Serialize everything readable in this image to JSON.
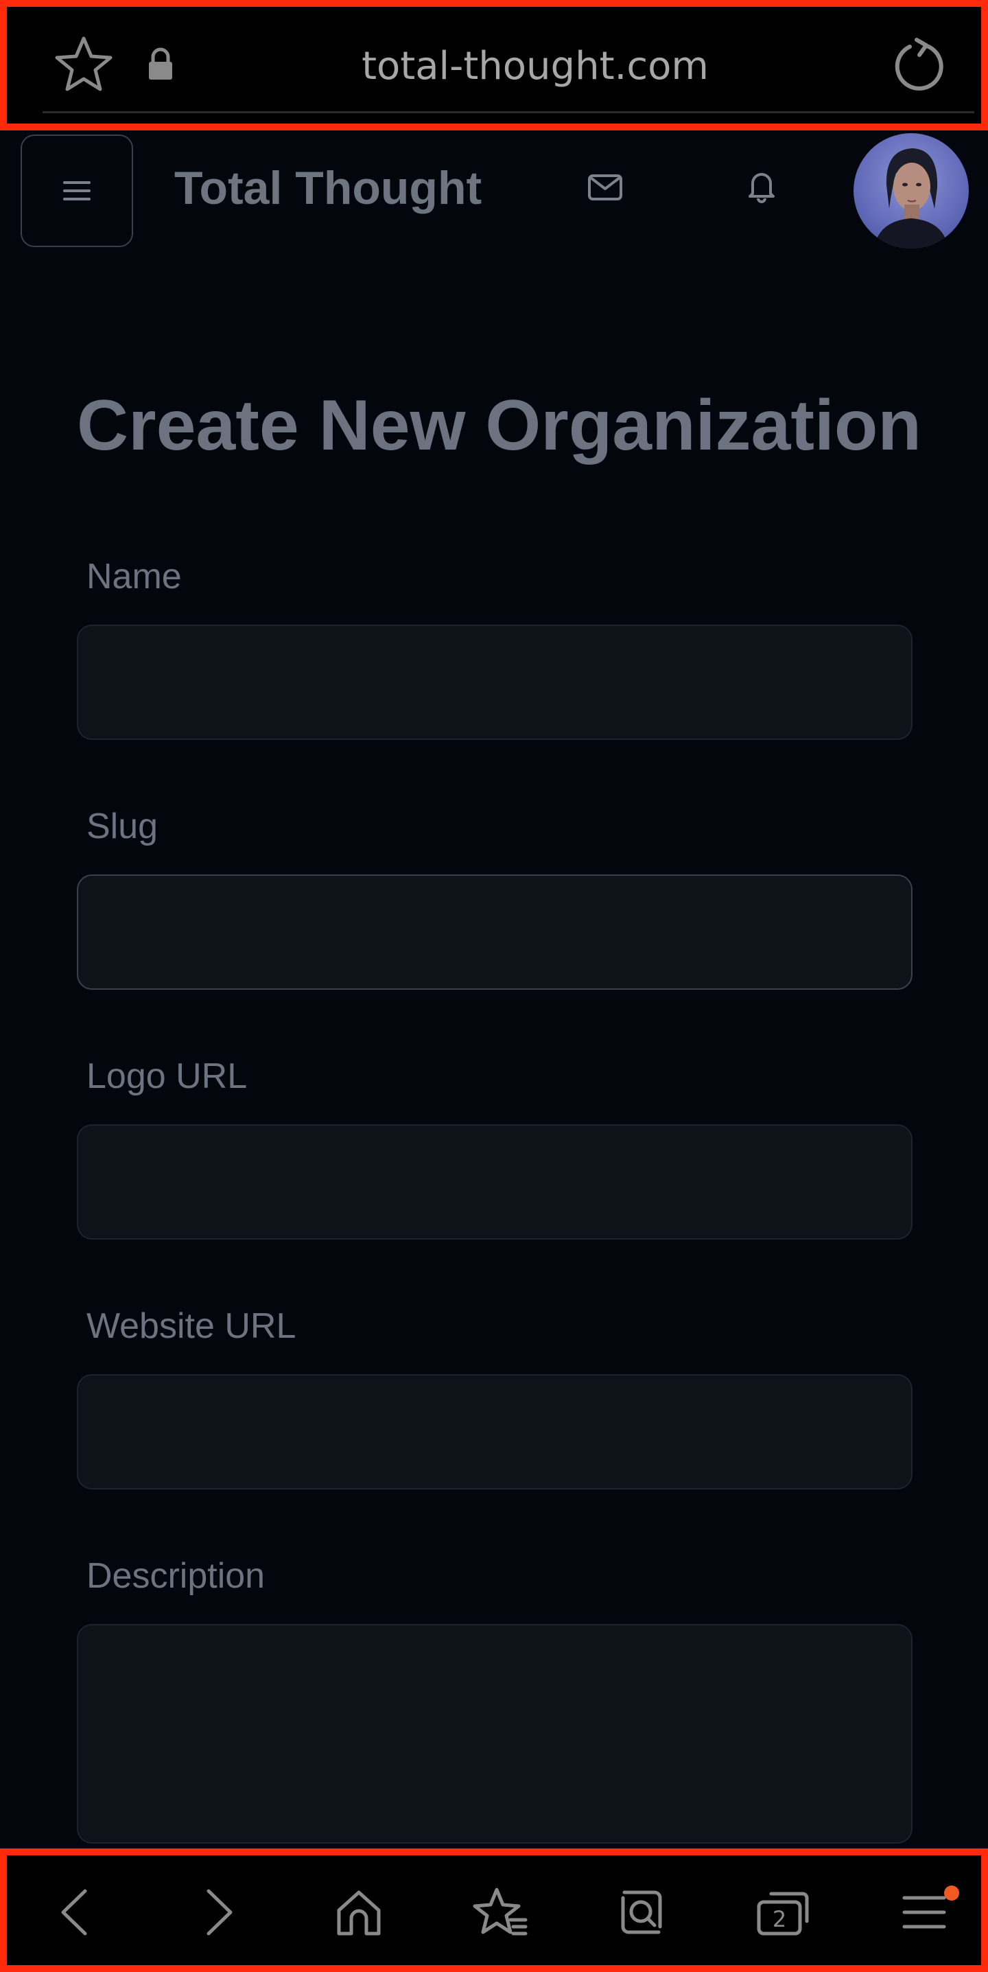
{
  "browser": {
    "url": "total-thought.com",
    "tab_count": "2"
  },
  "header": {
    "brand": "Total Thought"
  },
  "form": {
    "title": "Create New Organization",
    "fields": [
      {
        "label": "Name",
        "value": ""
      },
      {
        "label": "Slug",
        "value": ""
      },
      {
        "label": "Logo URL",
        "value": ""
      },
      {
        "label": "Website URL",
        "value": ""
      },
      {
        "label": "Description",
        "value": ""
      }
    ]
  },
  "icons": {
    "bookmark": "star-icon",
    "secure": "lock-icon",
    "reload": "reload-icon",
    "menu": "hamburger-icon",
    "messages": "mail-icon",
    "notifications": "bell-icon",
    "nav": [
      "back-icon",
      "forward-icon",
      "home-icon",
      "bookmarks-icon",
      "search-icon",
      "tabs-icon",
      "menu-icon"
    ]
  },
  "colors": {
    "highlight_border": "#ff2a0c",
    "background": "#03060d",
    "field_bg": "#0e1219",
    "notification_dot": "#f25a24"
  }
}
